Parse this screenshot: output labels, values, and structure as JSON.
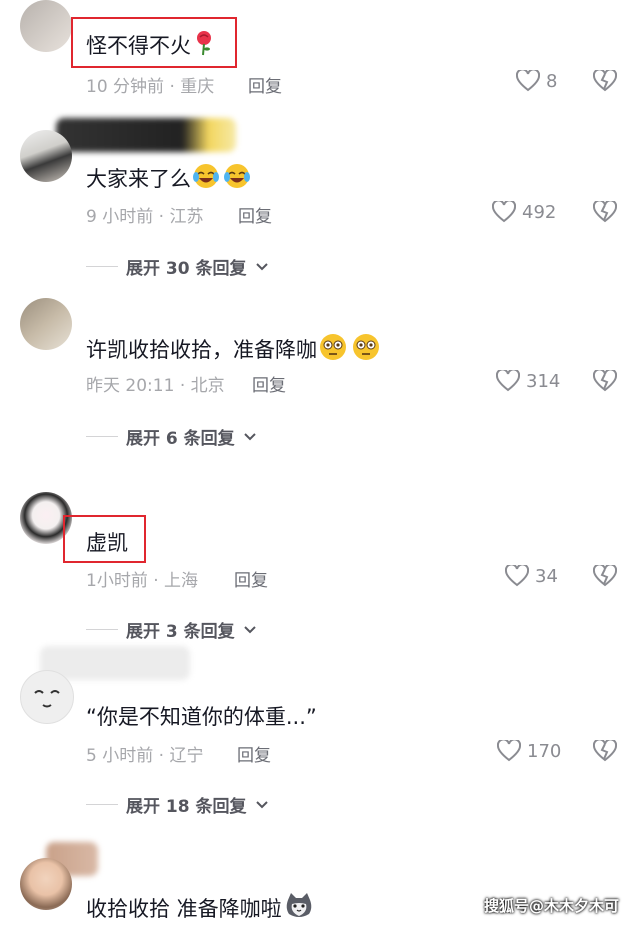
{
  "comments": [
    {
      "text": "怪不得不火",
      "emoji": "rose",
      "time": "10 分钟前",
      "location": "重庆",
      "reply": "回复",
      "likes": "8"
    },
    {
      "text": "大家来了么",
      "emoji": "laughing-crying-face",
      "time": "9 小时前",
      "location": "江苏",
      "reply": "回复",
      "likes": "492",
      "expand": "展开 30 条回复"
    },
    {
      "text": "许凯收拾收拾，准备降咖",
      "emoji": "flushed-face",
      "time": "昨天 20:11",
      "location": "北京",
      "reply": "回复",
      "likes": "314",
      "expand": "展开 6 条回复"
    },
    {
      "text": "虚凯",
      "time": "1小时前",
      "location": "上海",
      "reply": "回复",
      "likes": "34",
      "expand": "展开 3 条回复"
    },
    {
      "text": "“你是不知道你的体重...”",
      "time": "5 小时前",
      "location": "辽宁",
      "reply": "回复",
      "likes": "170",
      "expand": "展开 18 条回复"
    },
    {
      "text": "收拾收拾 准备降咖啦",
      "emoji": "cat-face"
    }
  ],
  "separator": "·",
  "watermark": "搜狐号@木木夕木可",
  "colors": {
    "highlight": "#e0262f",
    "meta": "#a6a7ab"
  }
}
